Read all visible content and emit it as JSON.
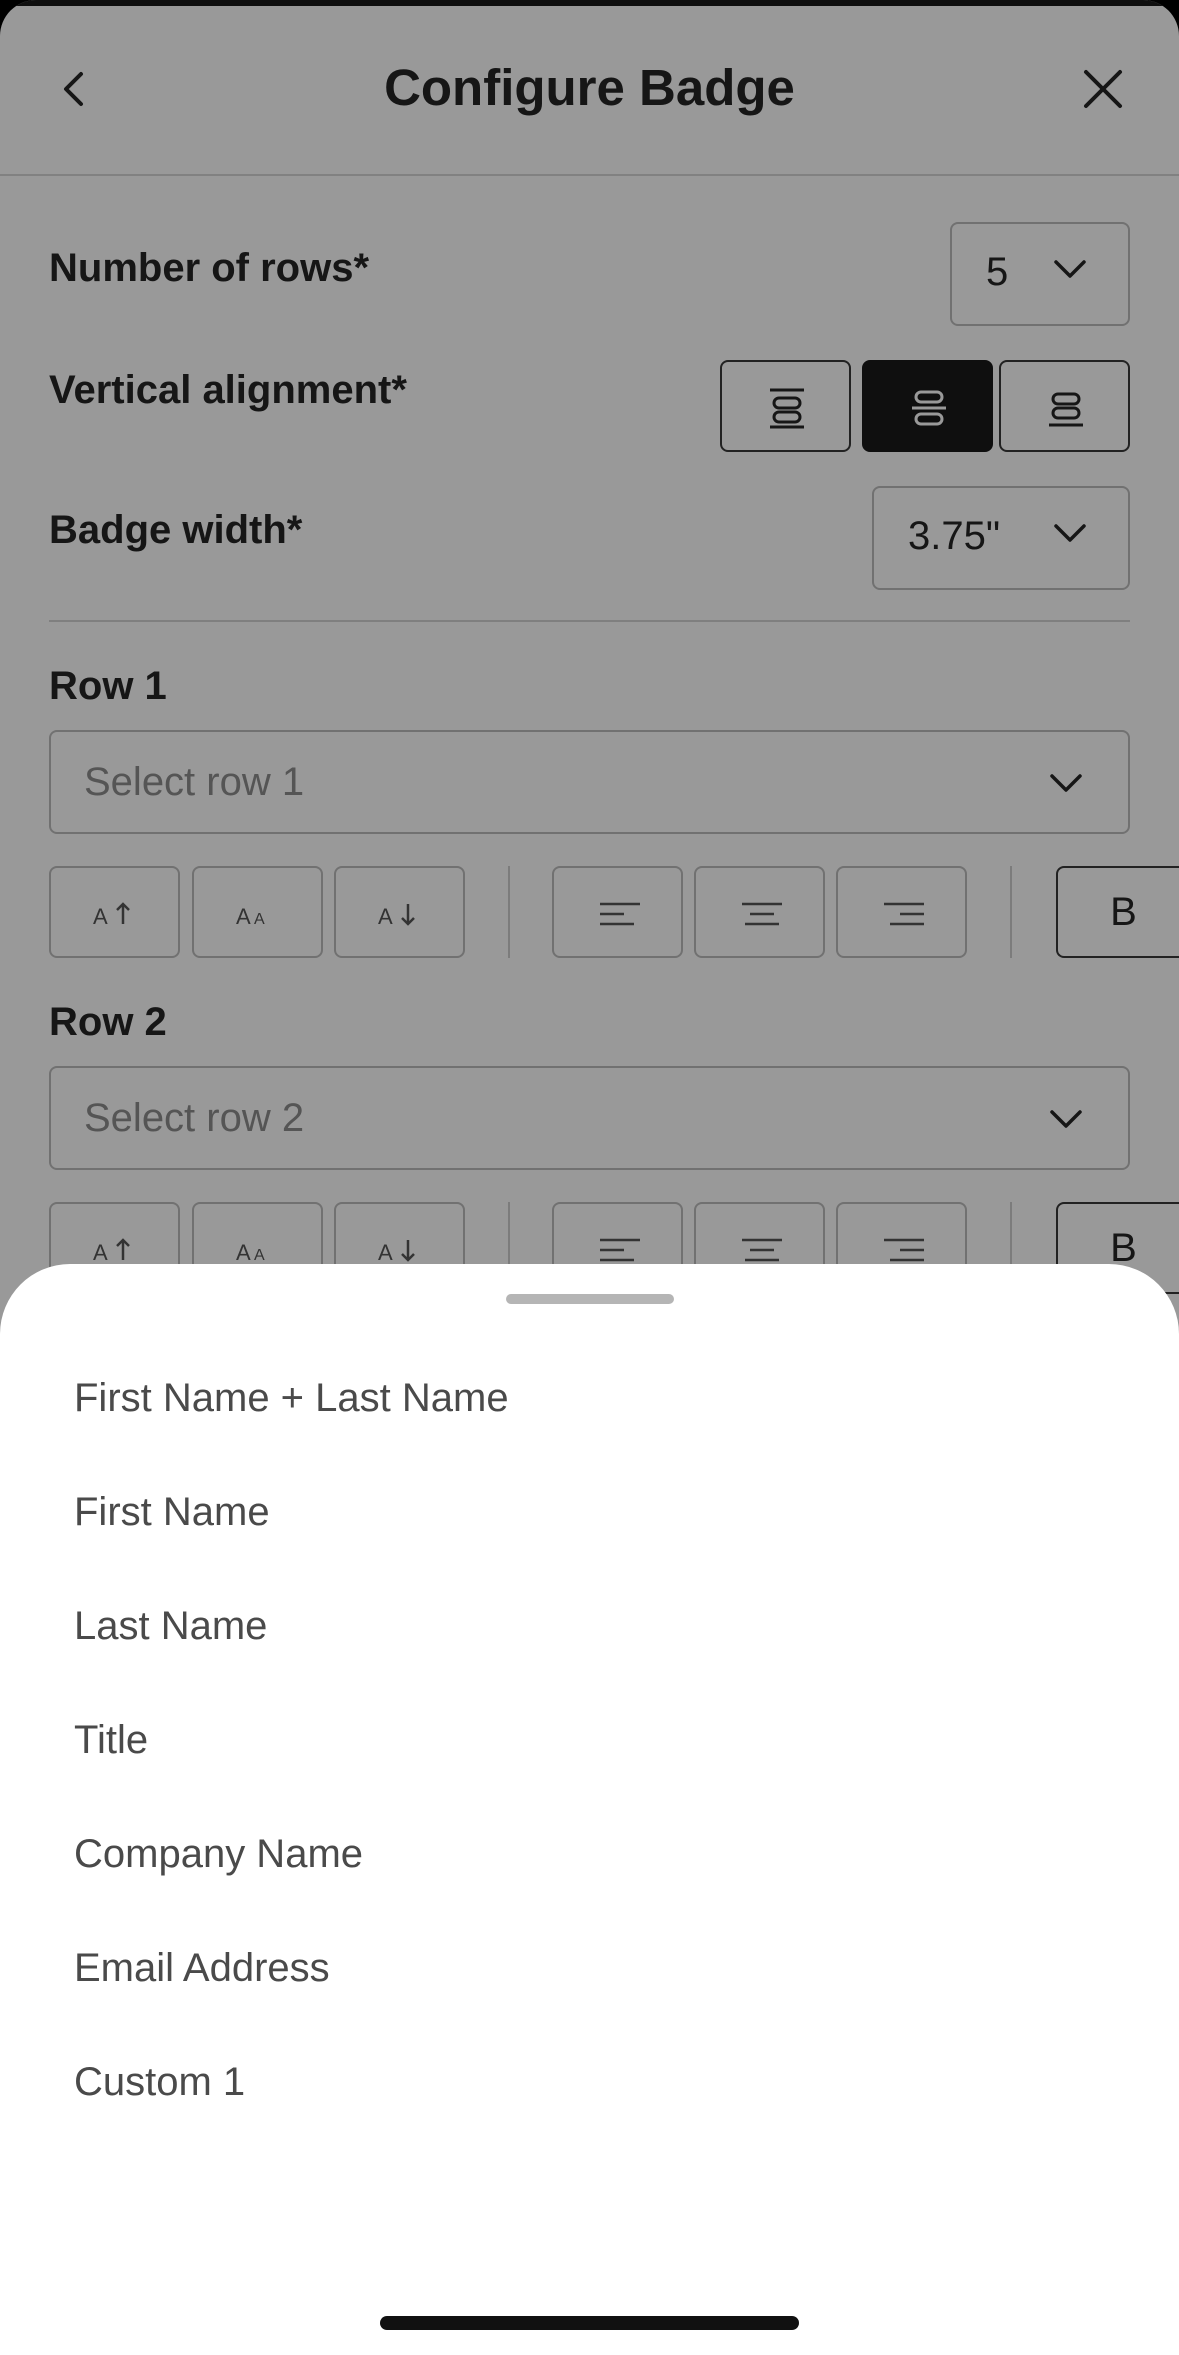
{
  "header": {
    "title": "Configure Badge",
    "back_icon": "chevron-left-icon",
    "close_icon": "close-icon"
  },
  "form": {
    "rows_label": "Number of rows*",
    "rows_value": "5",
    "vertical_alignment_label": "Vertical alignment*",
    "vertical_alignment_options": [
      "top",
      "center",
      "bottom"
    ],
    "vertical_alignment_selected": "center",
    "badge_width_label": "Badge width*",
    "badge_width_value": "3.75\""
  },
  "rows": [
    {
      "label": "Row 1",
      "placeholder": "Select row 1"
    },
    {
      "label": "Row 2",
      "placeholder": "Select row 2"
    }
  ],
  "toolbar": {
    "tools": [
      "increase-font-size",
      "font-size",
      "decrease-font-size",
      "align-left",
      "align-center",
      "align-right"
    ],
    "bold_label": "B"
  },
  "sheet": {
    "options": [
      "First Name + Last Name",
      "First Name",
      "Last Name",
      "Title",
      "Company Name",
      "Email Address",
      "Custom 1"
    ]
  },
  "colors": {
    "active": "#1a1a1a",
    "border": "#bdbdbd",
    "text": "#262626",
    "option_text": "#4a4a4a"
  }
}
